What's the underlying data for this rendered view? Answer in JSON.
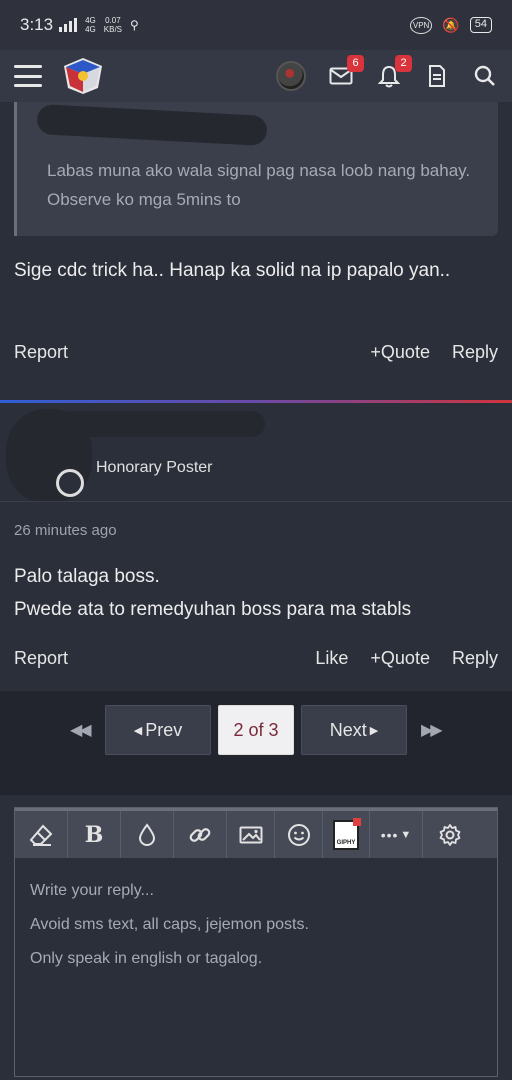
{
  "status_bar": {
    "time": "3:13",
    "network_top": "4G",
    "network_bottom": "4G",
    "speed_value": "0.07",
    "speed_unit": "KB/S",
    "vpn": "VPN",
    "battery": "54"
  },
  "header": {
    "messages_badge": "6",
    "alerts_badge": "2"
  },
  "post1": {
    "quote_text": "Labas muna ako wala signal pag nasa loob nang bahay. Observe ko mga 5mins to",
    "body": "Sige cdc trick ha.. Hanap ka solid na ip papalo yan..",
    "report": "Report",
    "quote": "Quote",
    "reply": "Reply"
  },
  "post2": {
    "user_title": "Honorary Poster",
    "timestamp": "26 minutes ago",
    "body_line1": "Palo talaga boss.",
    "body_line2": "Pwede ata to remedyuhan boss para ma stabls",
    "report": "Report",
    "like": "Like",
    "quote": "Quote",
    "reply": "Reply"
  },
  "pagination": {
    "prev": "Prev",
    "current": "2 of 3",
    "next": "Next"
  },
  "editor": {
    "giphy_label": "GIPHY",
    "placeholder": "Write your reply...\nAvoid sms text, all caps, jejemon posts.\nOnly speak in english or tagalog."
  }
}
